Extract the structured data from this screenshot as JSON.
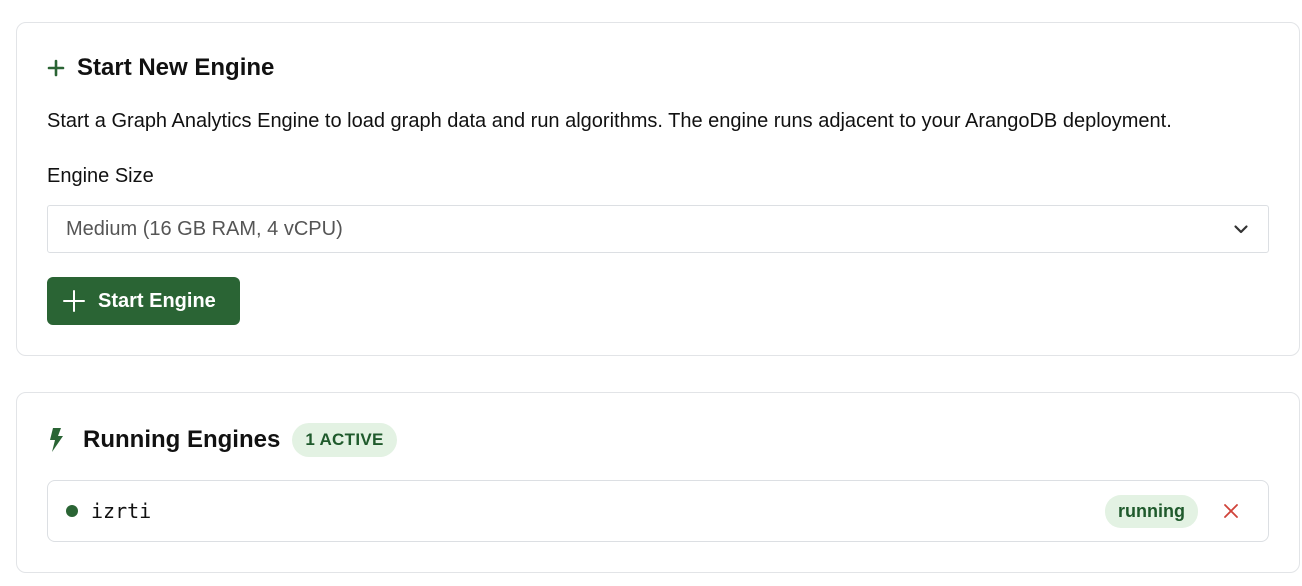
{
  "start_section": {
    "title": "Start New Engine",
    "title_icon": "plus-icon",
    "description": "Start a Graph Analytics Engine to load graph data and run algorithms. The engine runs adjacent to your ArangoDB deployment.",
    "engine_size_label": "Engine Size",
    "engine_size_selected": "Medium (16 GB RAM, 4 vCPU)",
    "start_button_label": "Start Engine"
  },
  "running_section": {
    "title": "Running Engines",
    "title_icon": "lightning-bolt-icon",
    "active_badge": "1 ACTIVE",
    "engines": [
      {
        "name": "izrti",
        "status": "running"
      }
    ]
  },
  "colors": {
    "primary_green": "#2a6434",
    "badge_bg": "#e3f2e3",
    "badge_text": "#1f5a2c",
    "remove_red": "#d0433a"
  }
}
